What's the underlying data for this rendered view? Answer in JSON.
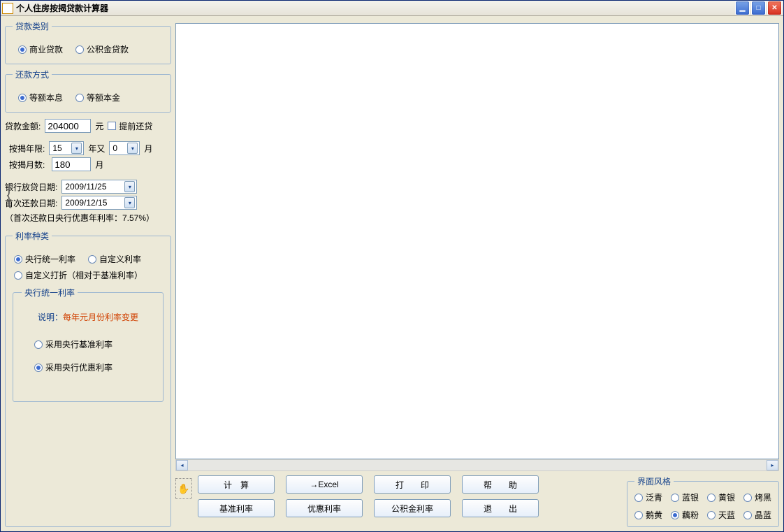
{
  "window": {
    "title": "个人住房按揭贷款计算器"
  },
  "loanType": {
    "legend": "贷款类别",
    "opt1": "商业贷款",
    "opt2": "公积金贷款"
  },
  "repayMode": {
    "legend": "还款方式",
    "opt1": "等额本息",
    "opt2": "等额本金"
  },
  "amount": {
    "label": "贷款金额:",
    "value": "204000",
    "unit": "元",
    "prepay": "提前还贷"
  },
  "term": {
    "yearsLabel": "按揭年限:",
    "yearsValue": "15",
    "yearsMid": "年又",
    "monthsExtra": "0",
    "monthsUnit": "月",
    "monthsLabel": "按揭月数:",
    "monthsValue": "180"
  },
  "dates": {
    "issueLabel": "银行放贷日期:",
    "issueValue": "2009/11/25",
    "firstLabel": "首次还款日期:",
    "firstValue": "2009/12/15",
    "note": "（首次还款日央行优惠年利率：7.57%）"
  },
  "rateType": {
    "legend": "利率种类",
    "opt1": "央行统一利率",
    "opt2": "自定义利率",
    "opt3": "自定义打折（相对于基准利率）",
    "subLegend": "央行统一利率",
    "noteKey": "说明：",
    "noteBody": "每年元月份利率变更",
    "sub1": "采用央行基准利率",
    "sub2": "采用央行优惠利率"
  },
  "buttons": {
    "calc": "计　算",
    "excel": "→Excel",
    "print": "打　　印",
    "help": "帮　　助",
    "baseRate": "基准利率",
    "favRate": "优惠利率",
    "gjjRate": "公积金利率",
    "exit": "退　　出"
  },
  "theme": {
    "legend": "界面风格",
    "o1": "泛青",
    "o2": "蓝银",
    "o3": "黄银",
    "o4": "烤黑",
    "o5": "鹅黄",
    "o6": "藕粉",
    "o7": "天蓝",
    "o8": "晶蓝"
  }
}
